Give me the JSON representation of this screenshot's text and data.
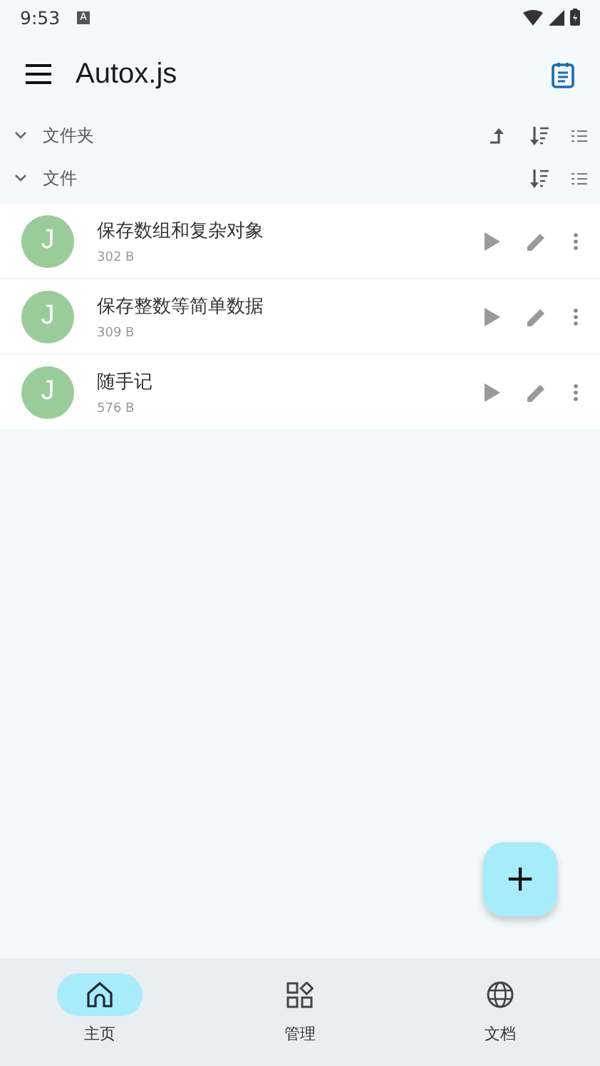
{
  "status_bar": {
    "time": "9:53",
    "notification": "A"
  },
  "app_bar": {
    "title": "Autox.js"
  },
  "sections": [
    {
      "label": "文件夹",
      "expanded": true,
      "actions": [
        {
          "kind": "up"
        },
        {
          "kind": "sort"
        },
        {
          "kind": "list"
        }
      ]
    },
    {
      "label": "文件",
      "expanded": true,
      "actions": [
        {
          "kind": "sort"
        },
        {
          "kind": "list"
        }
      ]
    }
  ],
  "files": [
    {
      "avatar": "J",
      "name": "保存数组和复杂对象",
      "size": "302 B"
    },
    {
      "avatar": "J",
      "name": "保存整数等简单数据",
      "size": "309 B"
    },
    {
      "avatar": "J",
      "name": "随手记",
      "size": "576 B"
    }
  ],
  "fab": {
    "label": "+"
  },
  "bottom_nav": [
    {
      "kind": "home",
      "label": "主页",
      "selected": true
    },
    {
      "kind": "manage",
      "label": "管理",
      "selected": false
    },
    {
      "kind": "docs",
      "label": "文档",
      "selected": false
    }
  ]
}
